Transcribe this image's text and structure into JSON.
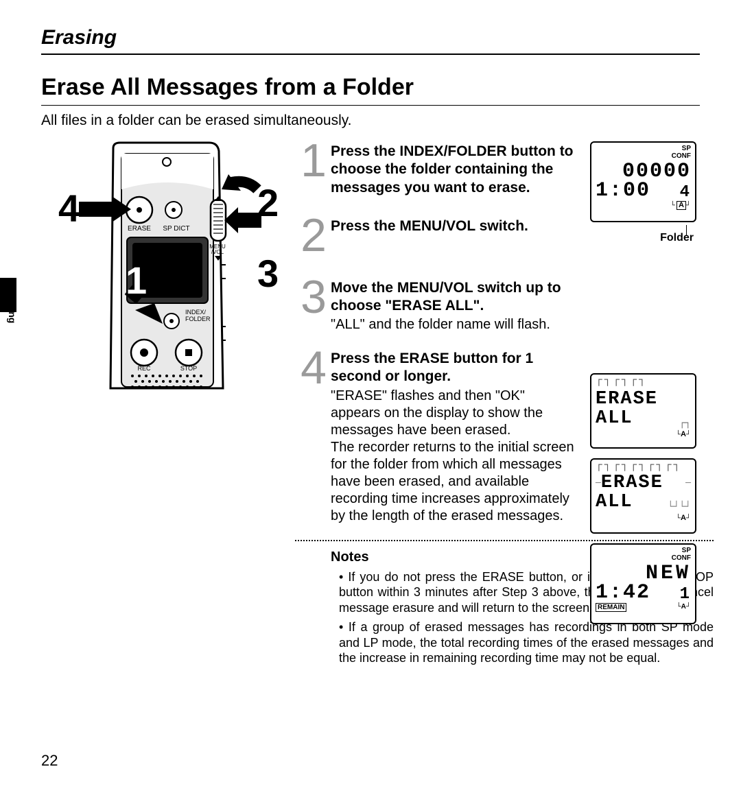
{
  "section_header": "Erasing",
  "side_tab": "Erasing",
  "title": "Erase All Messages from a Folder",
  "intro": "All files in a folder can be erased simultaneously.",
  "callouts": {
    "c1": "1",
    "c2": "2",
    "c3": "3",
    "c4": "4"
  },
  "steps": [
    {
      "num": "1",
      "title": "Press the INDEX/FOLDER button to choose the folder containing the messages you want to erase.",
      "desc": ""
    },
    {
      "num": "2",
      "title": "Press the MENU/VOL switch.",
      "desc": ""
    },
    {
      "num": "3",
      "title": "Move the MENU/VOL switch up to choose \"ERASE ALL\".",
      "desc": "\"ALL\" and the folder name will flash."
    },
    {
      "num": "4",
      "title": "Press the ERASE button for 1 second or longer.",
      "desc": "\"ERASE\" flashes and then \"OK\" appears on the display to show the messages have been erased.\nThe recorder returns to the initial screen for the folder from which all messages have been erased, and available recording time increases approximately by the length of the erased messages."
    }
  ],
  "notes_head": "Notes",
  "notes": [
    "If you do not press the ERASE button, or if you press the STOP button within 3 minutes after Step 3 above, the recorder will cancel message erasure and will return to the screen in Step 1.",
    "If a group of erased messages has recordings in both SP mode and LP mode,  the total recording times of the erased messages and the increase in remaining recording time may not be equal."
  ],
  "lcd1": {
    "sp": "SP",
    "conf": "CONF",
    "top_num": "00000",
    "time": "1:00",
    "right_num": "4",
    "folder_letter": "A",
    "caption": "Folder"
  },
  "lcd2": {
    "line1": "ERASE",
    "line2": "ALL",
    "folder_letter": "A"
  },
  "lcd3": {
    "line1": "ERASE",
    "line2": "ALL",
    "folder_letter": "A"
  },
  "lcd4": {
    "sp": "SP",
    "conf": "CONF",
    "top_text": "NEW",
    "time": "1:42",
    "right_num": "1",
    "remain": "REMAIN",
    "folder_letter": "A"
  },
  "device_labels": {
    "erase": "ERASE",
    "spdict": "SP DICT",
    "menu": "MENU",
    "vol": "/VOL",
    "index": "INDEX/",
    "folder": "FOLDER",
    "rec": "REC",
    "stop": "STOP"
  },
  "page_number": "22"
}
